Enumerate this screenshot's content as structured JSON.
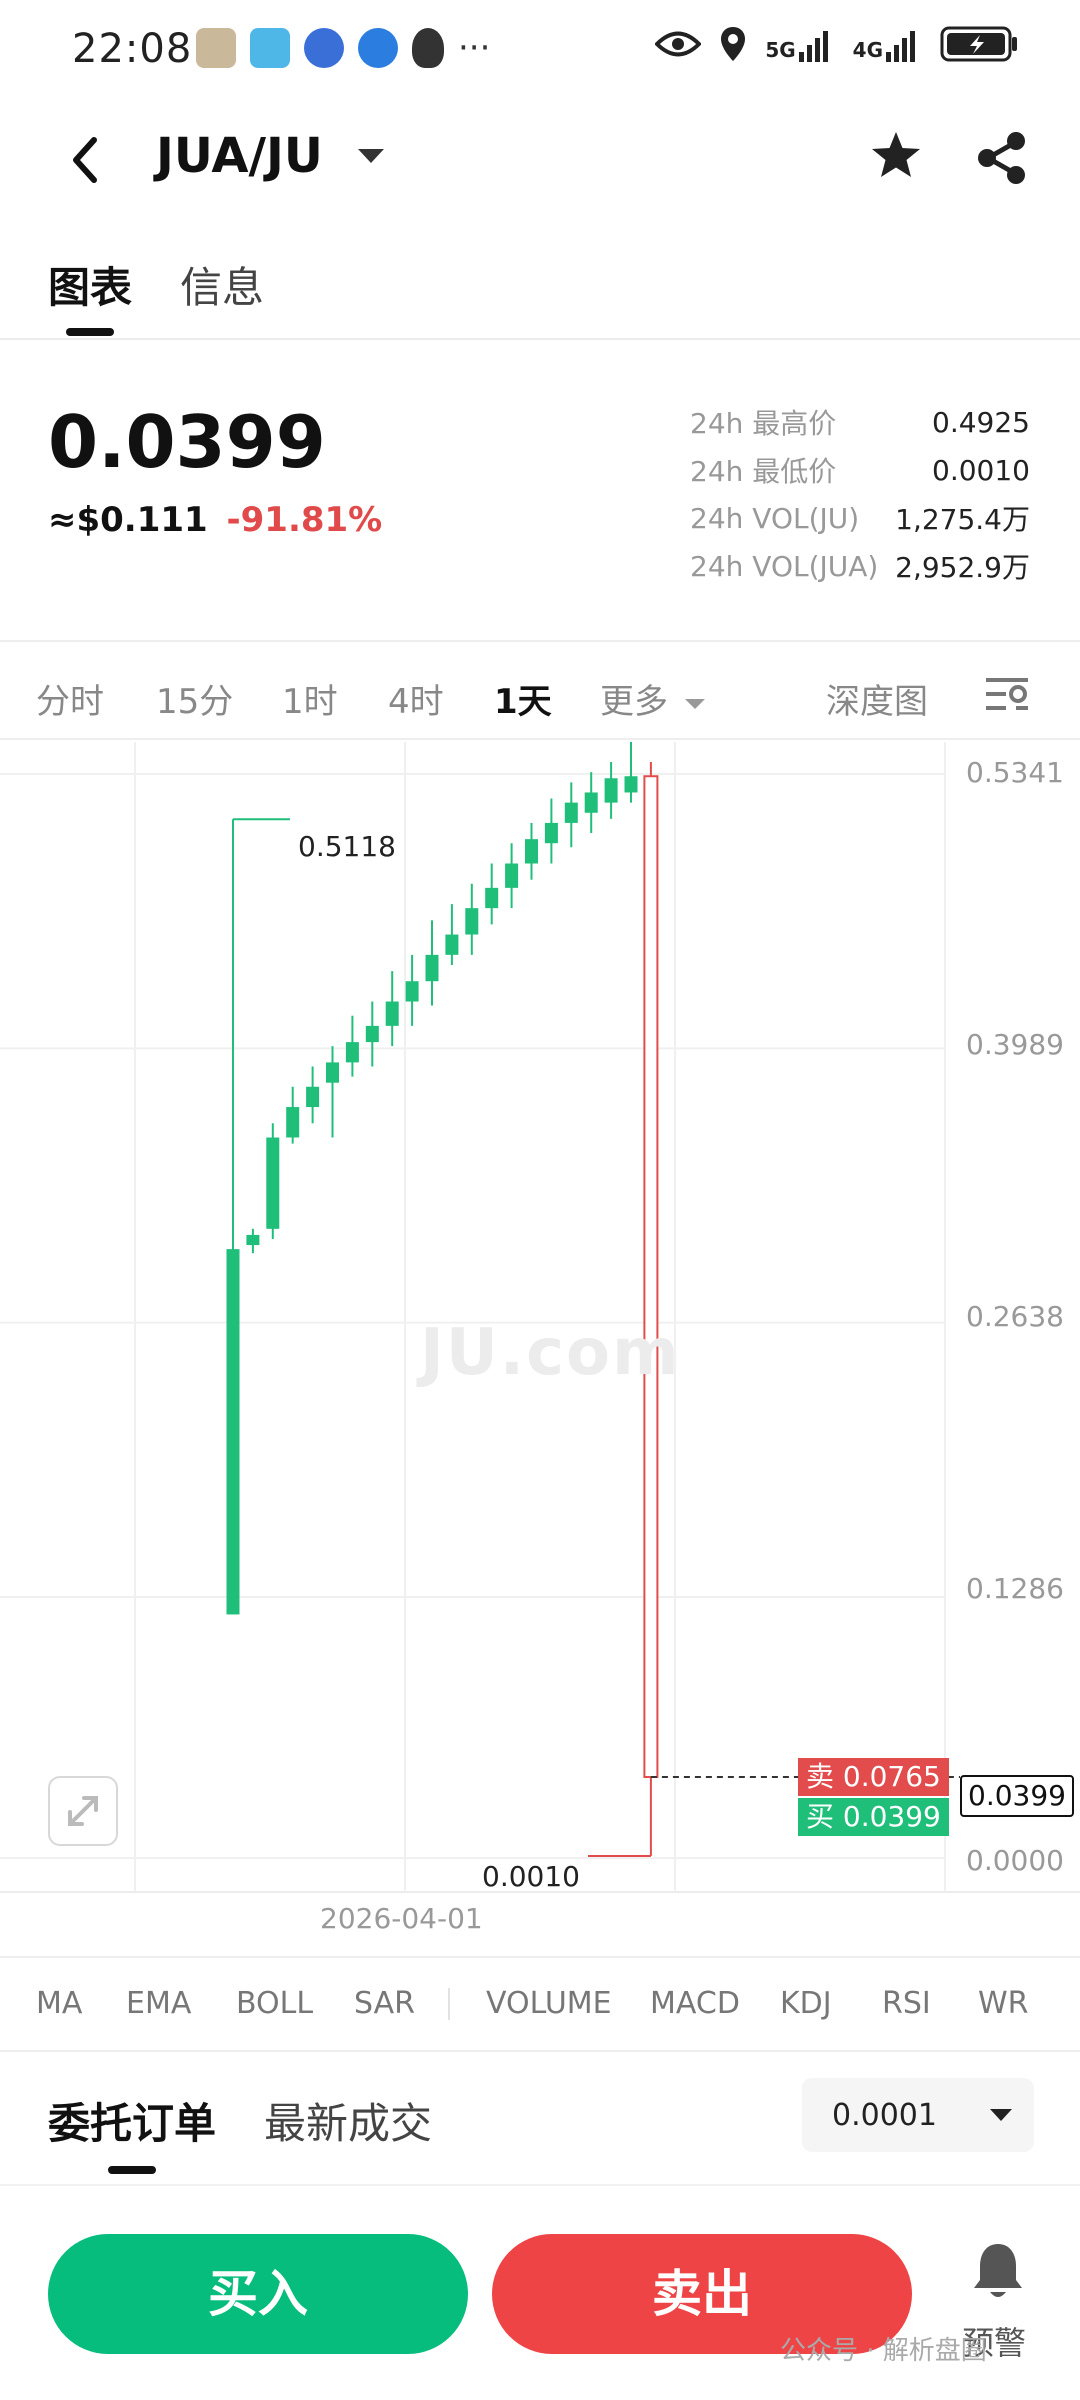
{
  "status_bar": {
    "time": "22:08",
    "network_1": "5G",
    "network_2": "4G",
    "more": "···"
  },
  "header": {
    "pair": "JUA/JU"
  },
  "tabs": {
    "chart": "图表",
    "info": "信息"
  },
  "price": {
    "last": "0.0399",
    "usd": "≈$0.111",
    "change": "-91.81%"
  },
  "stats": [
    {
      "label": "24h 最高价",
      "value": "0.4925"
    },
    {
      "label": "24h 最低价",
      "value": "0.0010"
    },
    {
      "label": "24h VOL(JU)",
      "value": "1,275.4万"
    },
    {
      "label": "24h VOL(JUA)",
      "value": "2,952.9万"
    }
  ],
  "intervals": {
    "items": [
      "分时",
      "15分",
      "1时",
      "4时",
      "1天",
      "更多"
    ],
    "active": "1天",
    "depth": "深度图"
  },
  "chart": {
    "price_axis": [
      "0.5341",
      "0.3989",
      "0.2638",
      "0.1286",
      "0.0000"
    ],
    "date_label": "2026-04-01",
    "high_marker": "0.5118",
    "low_marker": "0.0010",
    "sell_tag": "卖 0.0765",
    "buy_tag": "买 0.0399",
    "current_price": "0.0399",
    "watermark": "JU.com",
    "up_color": "#1fbf7a",
    "down_color": "#e24c4c"
  },
  "chart_data": {
    "type": "candlestick",
    "ylim": [
      0,
      0.5341
    ],
    "y_ticks": [
      0.5341,
      0.3989,
      0.2638,
      0.1286,
      0.0
    ],
    "x_tick_label": "2026-04-01",
    "candles": [
      {
        "open": 0.12,
        "close": 0.3,
        "high": 0.5118,
        "low": 0.12
      },
      {
        "open": 0.302,
        "close": 0.307,
        "high": 0.31,
        "low": 0.298
      },
      {
        "open": 0.31,
        "close": 0.355,
        "high": 0.362,
        "low": 0.305
      },
      {
        "open": 0.355,
        "close": 0.37,
        "high": 0.38,
        "low": 0.352
      },
      {
        "open": 0.37,
        "close": 0.38,
        "high": 0.39,
        "low": 0.362
      },
      {
        "open": 0.382,
        "close": 0.392,
        "high": 0.4,
        "low": 0.355
      },
      {
        "open": 0.392,
        "close": 0.402,
        "high": 0.415,
        "low": 0.385
      },
      {
        "open": 0.402,
        "close": 0.41,
        "high": 0.422,
        "low": 0.39
      },
      {
        "open": 0.41,
        "close": 0.422,
        "high": 0.437,
        "low": 0.4
      },
      {
        "open": 0.422,
        "close": 0.432,
        "high": 0.445,
        "low": 0.41
      },
      {
        "open": 0.432,
        "close": 0.445,
        "high": 0.462,
        "low": 0.42
      },
      {
        "open": 0.445,
        "close": 0.455,
        "high": 0.47,
        "low": 0.44
      },
      {
        "open": 0.455,
        "close": 0.468,
        "high": 0.48,
        "low": 0.445
      },
      {
        "open": 0.468,
        "close": 0.478,
        "high": 0.49,
        "low": 0.46
      },
      {
        "open": 0.478,
        "close": 0.49,
        "high": 0.5,
        "low": 0.468
      },
      {
        "open": 0.49,
        "close": 0.502,
        "high": 0.51,
        "low": 0.482
      },
      {
        "open": 0.5,
        "close": 0.51,
        "high": 0.522,
        "low": 0.49
      },
      {
        "open": 0.51,
        "close": 0.52,
        "high": 0.53,
        "low": 0.498
      },
      {
        "open": 0.515,
        "close": 0.525,
        "high": 0.535,
        "low": 0.505
      },
      {
        "open": 0.52,
        "close": 0.532,
        "high": 0.54,
        "low": 0.512
      },
      {
        "open": 0.525,
        "close": 0.533,
        "high": 0.555,
        "low": 0.52
      },
      {
        "open": 0.533,
        "close": 0.0399,
        "high": 0.54,
        "low": 0.001
      }
    ]
  },
  "indicators": [
    "MA",
    "EMA",
    "BOLL",
    "SAR",
    "VOLUME",
    "MACD",
    "KDJ",
    "RSI",
    "WR"
  ],
  "orders": {
    "tab_orders": "委托订单",
    "tab_trades": "最新成交",
    "precision": "0.0001"
  },
  "footer": {
    "buy": "买入",
    "sell": "卖出",
    "alert": "预警",
    "wechat_watermark": "公众号 · 解析盘圈"
  }
}
